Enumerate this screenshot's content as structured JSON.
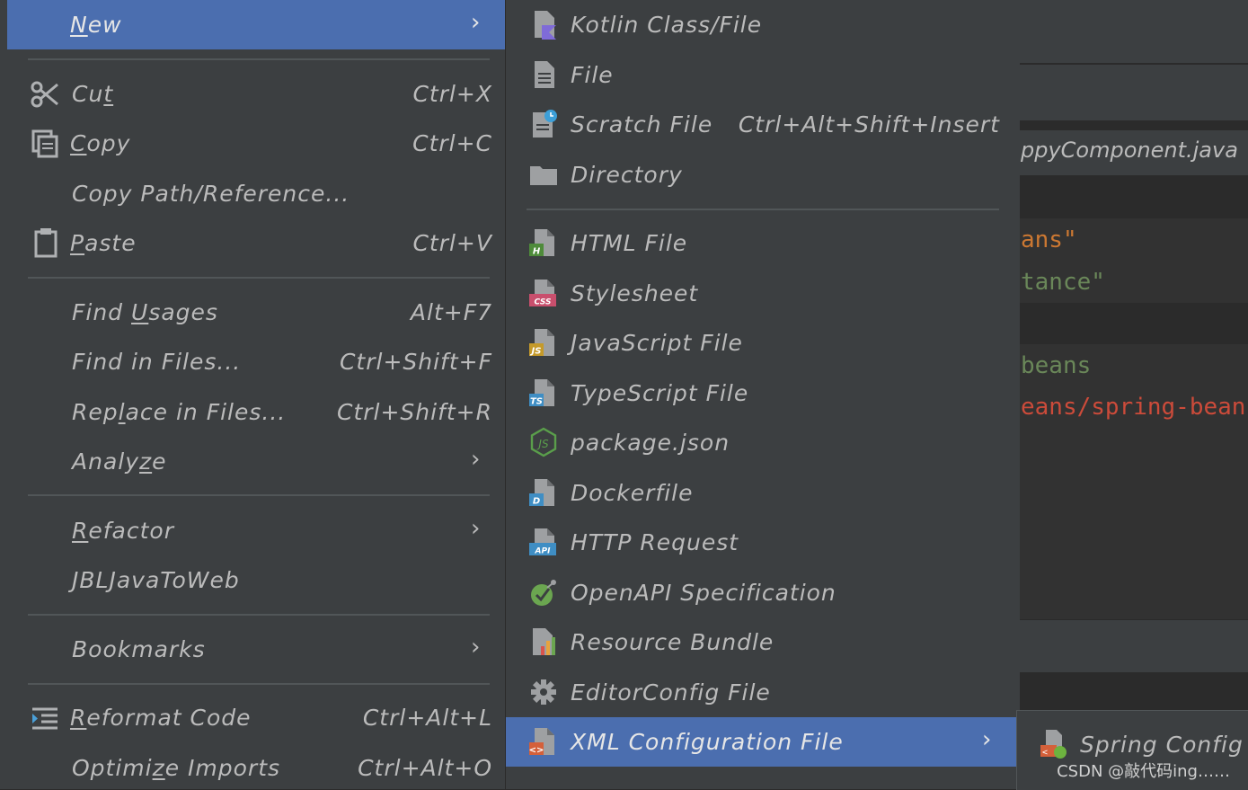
{
  "editor": {
    "tab_title": "ppyComponent.java",
    "lines": [
      {
        "text": "ans\"",
        "color": "#cc7832"
      },
      {
        "text": "tance\"",
        "color": "#6a8759"
      },
      {
        "text": "beans",
        "color": "#6a8759"
      },
      {
        "text": "eans/spring-bean",
        "color": "#cc4b3a"
      }
    ]
  },
  "context_menu": {
    "items": [
      {
        "id": "new",
        "label": "New",
        "mnemonic": "N",
        "has_submenu": true,
        "selected": true
      },
      {
        "id": "cut",
        "label": "Cut",
        "shortcut": "Ctrl+X",
        "icon": "scissors-icon"
      },
      {
        "id": "copy",
        "label": "Copy",
        "shortcut": "Ctrl+C",
        "icon": "copy-icon"
      },
      {
        "id": "copy-path",
        "label": "Copy Path/Reference..."
      },
      {
        "id": "paste",
        "label": "Paste",
        "shortcut": "Ctrl+V",
        "icon": "clipboard-icon"
      },
      {
        "id": "find-usages",
        "label": "Find Usages",
        "shortcut": "Alt+F7"
      },
      {
        "id": "find-in-files",
        "label": "Find in Files...",
        "shortcut": "Ctrl+Shift+F"
      },
      {
        "id": "replace-in-files",
        "label": "Replace in Files...",
        "shortcut": "Ctrl+Shift+R"
      },
      {
        "id": "analyze",
        "label": "Analyze",
        "has_submenu": true
      },
      {
        "id": "refactor",
        "label": "Refactor",
        "has_submenu": true
      },
      {
        "id": "jbljavatoweb",
        "label": "JBLJavaToWeb"
      },
      {
        "id": "bookmarks",
        "label": "Bookmarks",
        "has_submenu": true
      },
      {
        "id": "reformat-code",
        "label": "Reformat Code",
        "shortcut": "Ctrl+Alt+L",
        "icon": "reformat-icon"
      },
      {
        "id": "optimize-imports",
        "label": "Optimize Imports",
        "shortcut": "Ctrl+Alt+O"
      }
    ]
  },
  "new_submenu": {
    "items": [
      {
        "id": "kotlin",
        "label": "Kotlin Class/File",
        "icon": "kotlin-file-icon"
      },
      {
        "id": "file",
        "label": "File",
        "icon": "file-icon"
      },
      {
        "id": "scratch",
        "label": "Scratch File",
        "shortcut": "Ctrl+Alt+Shift+Insert",
        "icon": "scratch-file-icon"
      },
      {
        "id": "directory",
        "label": "Directory",
        "icon": "folder-icon"
      },
      {
        "id": "html",
        "label": "HTML File",
        "icon": "html-file-icon",
        "badge": "H",
        "badge_color": "#4e8b3a"
      },
      {
        "id": "stylesheet",
        "label": "Stylesheet",
        "icon": "css-file-icon",
        "badge": "CSS",
        "badge_color": "#c94f6d"
      },
      {
        "id": "javascript",
        "label": "JavaScript File",
        "icon": "js-file-icon",
        "badge": "JS",
        "badge_color": "#c59a2a"
      },
      {
        "id": "typescript",
        "label": "TypeScript File",
        "icon": "ts-file-icon",
        "badge": "TS",
        "badge_color": "#3f8ec4"
      },
      {
        "id": "package-json",
        "label": "package.json",
        "icon": "nodejs-icon"
      },
      {
        "id": "dockerfile",
        "label": "Dockerfile",
        "icon": "docker-file-icon",
        "badge": "D",
        "badge_color": "#3f8ec4"
      },
      {
        "id": "http-request",
        "label": "HTTP Request",
        "icon": "api-file-icon",
        "badge": "API",
        "badge_color": "#3f8ec4"
      },
      {
        "id": "openapi",
        "label": "OpenAPI Specification",
        "icon": "openapi-icon"
      },
      {
        "id": "resource-bundle",
        "label": "Resource Bundle",
        "icon": "resource-bundle-icon"
      },
      {
        "id": "editorconfig",
        "label": "EditorConfig File",
        "icon": "gear-icon"
      },
      {
        "id": "xml-config",
        "label": "XML Configuration File",
        "icon": "xml-file-icon",
        "badge": "<>",
        "badge_color": "#d4603a",
        "has_submenu": true,
        "selected": true
      }
    ]
  },
  "xml_submenu": {
    "items": [
      {
        "id": "spring-config",
        "label": "Spring Config",
        "icon": "spring-xml-icon"
      }
    ]
  },
  "watermark": "CSDN @敲代码ing……",
  "colors": {
    "menu_bg": "#3c3f41",
    "selection": "#4b6eaf",
    "separator": "#515658",
    "text": "#bbbbbb"
  }
}
